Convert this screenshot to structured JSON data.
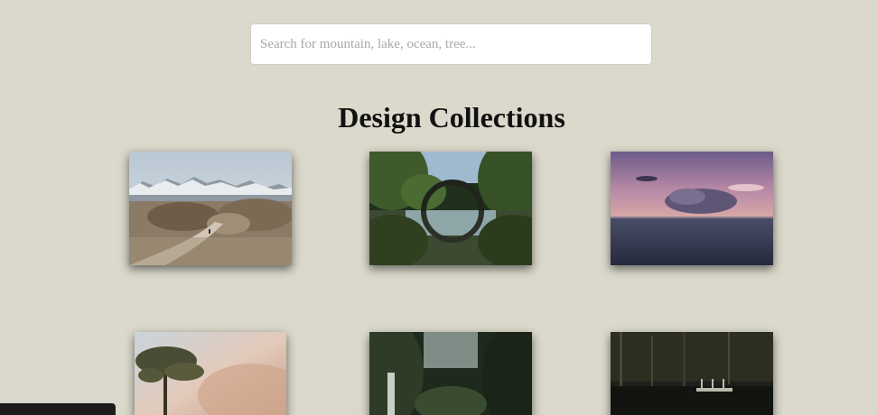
{
  "search": {
    "placeholder": "Search for mountain, lake, ocean, tree..."
  },
  "page": {
    "title": "Design Collections"
  }
}
